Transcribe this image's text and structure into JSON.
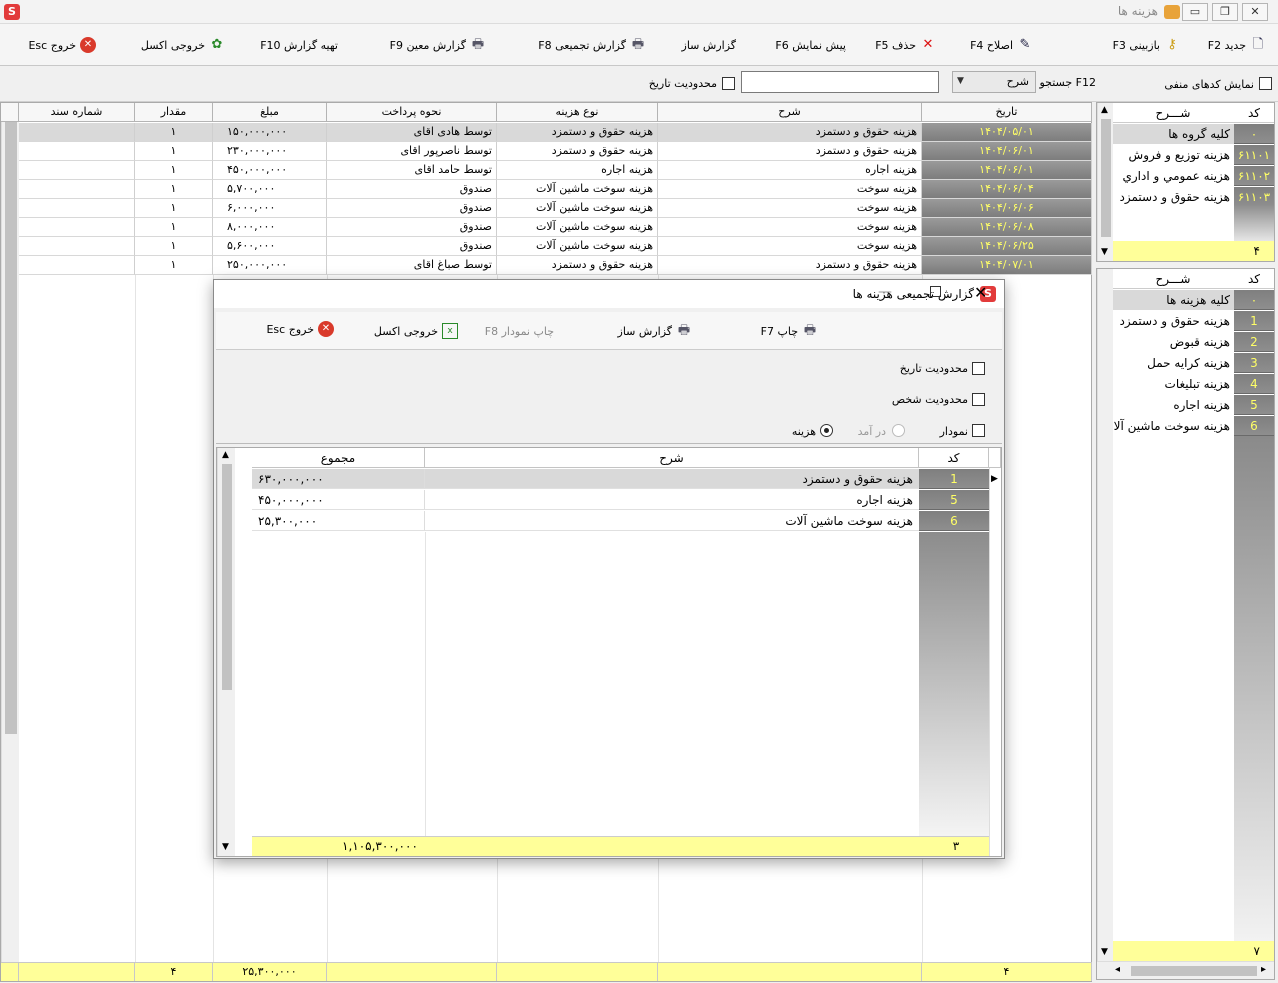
{
  "window": {
    "title": "هزینه ها",
    "logo": "S"
  },
  "toolbar": {
    "new": "جدید F2",
    "review": "بازبینی F3",
    "edit": "اصلاح F4",
    "delete": "حذف F5",
    "preview": "پیش نمایش F6",
    "report_builder": "گزارش ساز",
    "summary_report": "گزارش تجمیعی F8",
    "specific_report": "گزارش معین F9",
    "prepare_report": "تهیه گزارش F10",
    "excel": "خروجی اکسل",
    "exit": "خروج Esc"
  },
  "filters": {
    "show_negative": "نمایش کدهای منفی",
    "search_label": "F12 جستجو",
    "search_field": "شرح",
    "search_value": "",
    "date_limit": "محدودیت تاریخ"
  },
  "main_table": {
    "columns": [
      "تاریخ",
      "شرح",
      "نوع هزینه",
      "نحوه پرداخت",
      "مبلغ",
      "مقدار",
      "شماره سند"
    ],
    "rows": [
      {
        "date": "۱۴۰۴/۰۵/۰۱",
        "desc": "هزینه حقوق و دستمزد",
        "type": "هزینه حقوق و دستمزد",
        "pay": "توسط هادی اقای",
        "amount": "۱۵۰,۰۰۰,۰۰۰",
        "qty": "۱",
        "doc": ""
      },
      {
        "date": "۱۴۰۴/۰۶/۰۱",
        "desc": "هزینه حقوق و دستمزد",
        "type": "هزینه حقوق و دستمزد",
        "pay": "توسط ناصرپور اقای",
        "amount": "۲۳۰,۰۰۰,۰۰۰",
        "qty": "۱",
        "doc": ""
      },
      {
        "date": "۱۴۰۴/۰۶/۰۱",
        "desc": "هزینه اجاره",
        "type": "هزینه اجاره",
        "pay": "توسط حامد اقای",
        "amount": "۴۵۰,۰۰۰,۰۰۰",
        "qty": "۱",
        "doc": ""
      },
      {
        "date": "۱۴۰۴/۰۶/۰۴",
        "desc": "هزینه سوخت",
        "type": "هزینه سوخت ماشین آلات",
        "pay": "صندوق",
        "amount": "۵,۷۰۰,۰۰۰",
        "qty": "۱",
        "doc": ""
      },
      {
        "date": "۱۴۰۴/۰۶/۰۶",
        "desc": "هزینه سوخت",
        "type": "هزینه سوخت ماشین آلات",
        "pay": "صندوق",
        "amount": "۶,۰۰۰,۰۰۰",
        "qty": "۱",
        "doc": ""
      },
      {
        "date": "۱۴۰۴/۰۶/۰۸",
        "desc": "هزینه سوخت",
        "type": "هزینه سوخت ماشین آلات",
        "pay": "صندوق",
        "amount": "۸,۰۰۰,۰۰۰",
        "qty": "۱",
        "doc": ""
      },
      {
        "date": "۱۴۰۴/۰۶/۲۵",
        "desc": "هزینه سوخت",
        "type": "هزینه سوخت ماشین آلات",
        "pay": "صندوق",
        "amount": "۵,۶۰۰,۰۰۰",
        "qty": "۱",
        "doc": ""
      },
      {
        "date": "۱۴۰۴/۰۷/۰۱",
        "desc": "هزینه حقوق و دستمزد",
        "type": "هزینه حقوق و دستمزد",
        "pay": "توسط صباغ اقای",
        "amount": "۲۵۰,۰۰۰,۰۰۰",
        "qty": "۱",
        "doc": ""
      }
    ],
    "footer": {
      "count": "۴",
      "amount": "۲۵,۳۰۰,۰۰۰",
      "qty": "۴"
    }
  },
  "group_panel": {
    "header_code": "کد",
    "header_desc": "شـــرح",
    "items": [
      {
        "code": "۰",
        "desc": "کلیه گروه ها"
      },
      {
        "code": "۶۱۱۰۱",
        "desc": "هزینه توزیع و فروش"
      },
      {
        "code": "۶۱۱۰۲",
        "desc": "هزینه عمومي و اداري"
      },
      {
        "code": "۶۱۱۰۳",
        "desc": "هزینه حقوق و دستمزد"
      }
    ],
    "footer_count": "۴"
  },
  "expense_panel": {
    "header_code": "کد",
    "header_desc": "شـــرح",
    "items": [
      {
        "code": "۰",
        "desc": "کلیه هزینه ها"
      },
      {
        "code": "1",
        "desc": "هزینه حقوق و دستمزد"
      },
      {
        "code": "2",
        "desc": "هزینه قبوض"
      },
      {
        "code": "3",
        "desc": "هزینه کرایه حمل"
      },
      {
        "code": "4",
        "desc": "هزینه تبلیغات"
      },
      {
        "code": "5",
        "desc": "هزینه اجاره"
      },
      {
        "code": "6",
        "desc": "هزینه سوخت ماشین آلات"
      }
    ],
    "footer_count": "۷"
  },
  "dialog": {
    "title": "گزارش تجمیعی هزینه ها",
    "toolbar": {
      "print": "چاپ F7",
      "report_builder": "گزارش ساز",
      "chart_print": "چاپ نمودار F8",
      "excel": "خروجی اکسل",
      "exit": "خروج Esc"
    },
    "options": {
      "date_limit": "محدودیت تاریخ",
      "person_limit": "محدودیت شخص",
      "chart": "نمودار",
      "income": "در آمد",
      "expense": "هزینه"
    },
    "table": {
      "columns": [
        "کد",
        "شرح",
        "مجموع"
      ],
      "rows": [
        {
          "code": "1",
          "desc": "هزینه حقوق و دستمزد",
          "total": "۶۳۰,۰۰۰,۰۰۰"
        },
        {
          "code": "5",
          "desc": "هزینه اجاره",
          "total": "۴۵۰,۰۰۰,۰۰۰"
        },
        {
          "code": "6",
          "desc": "هزینه سوخت ماشین آلات",
          "total": "۲۵,۳۰۰,۰۰۰"
        }
      ],
      "footer": {
        "count": "۳",
        "total": "۱,۱۰۵,۳۰۰,۰۰۰"
      }
    }
  }
}
